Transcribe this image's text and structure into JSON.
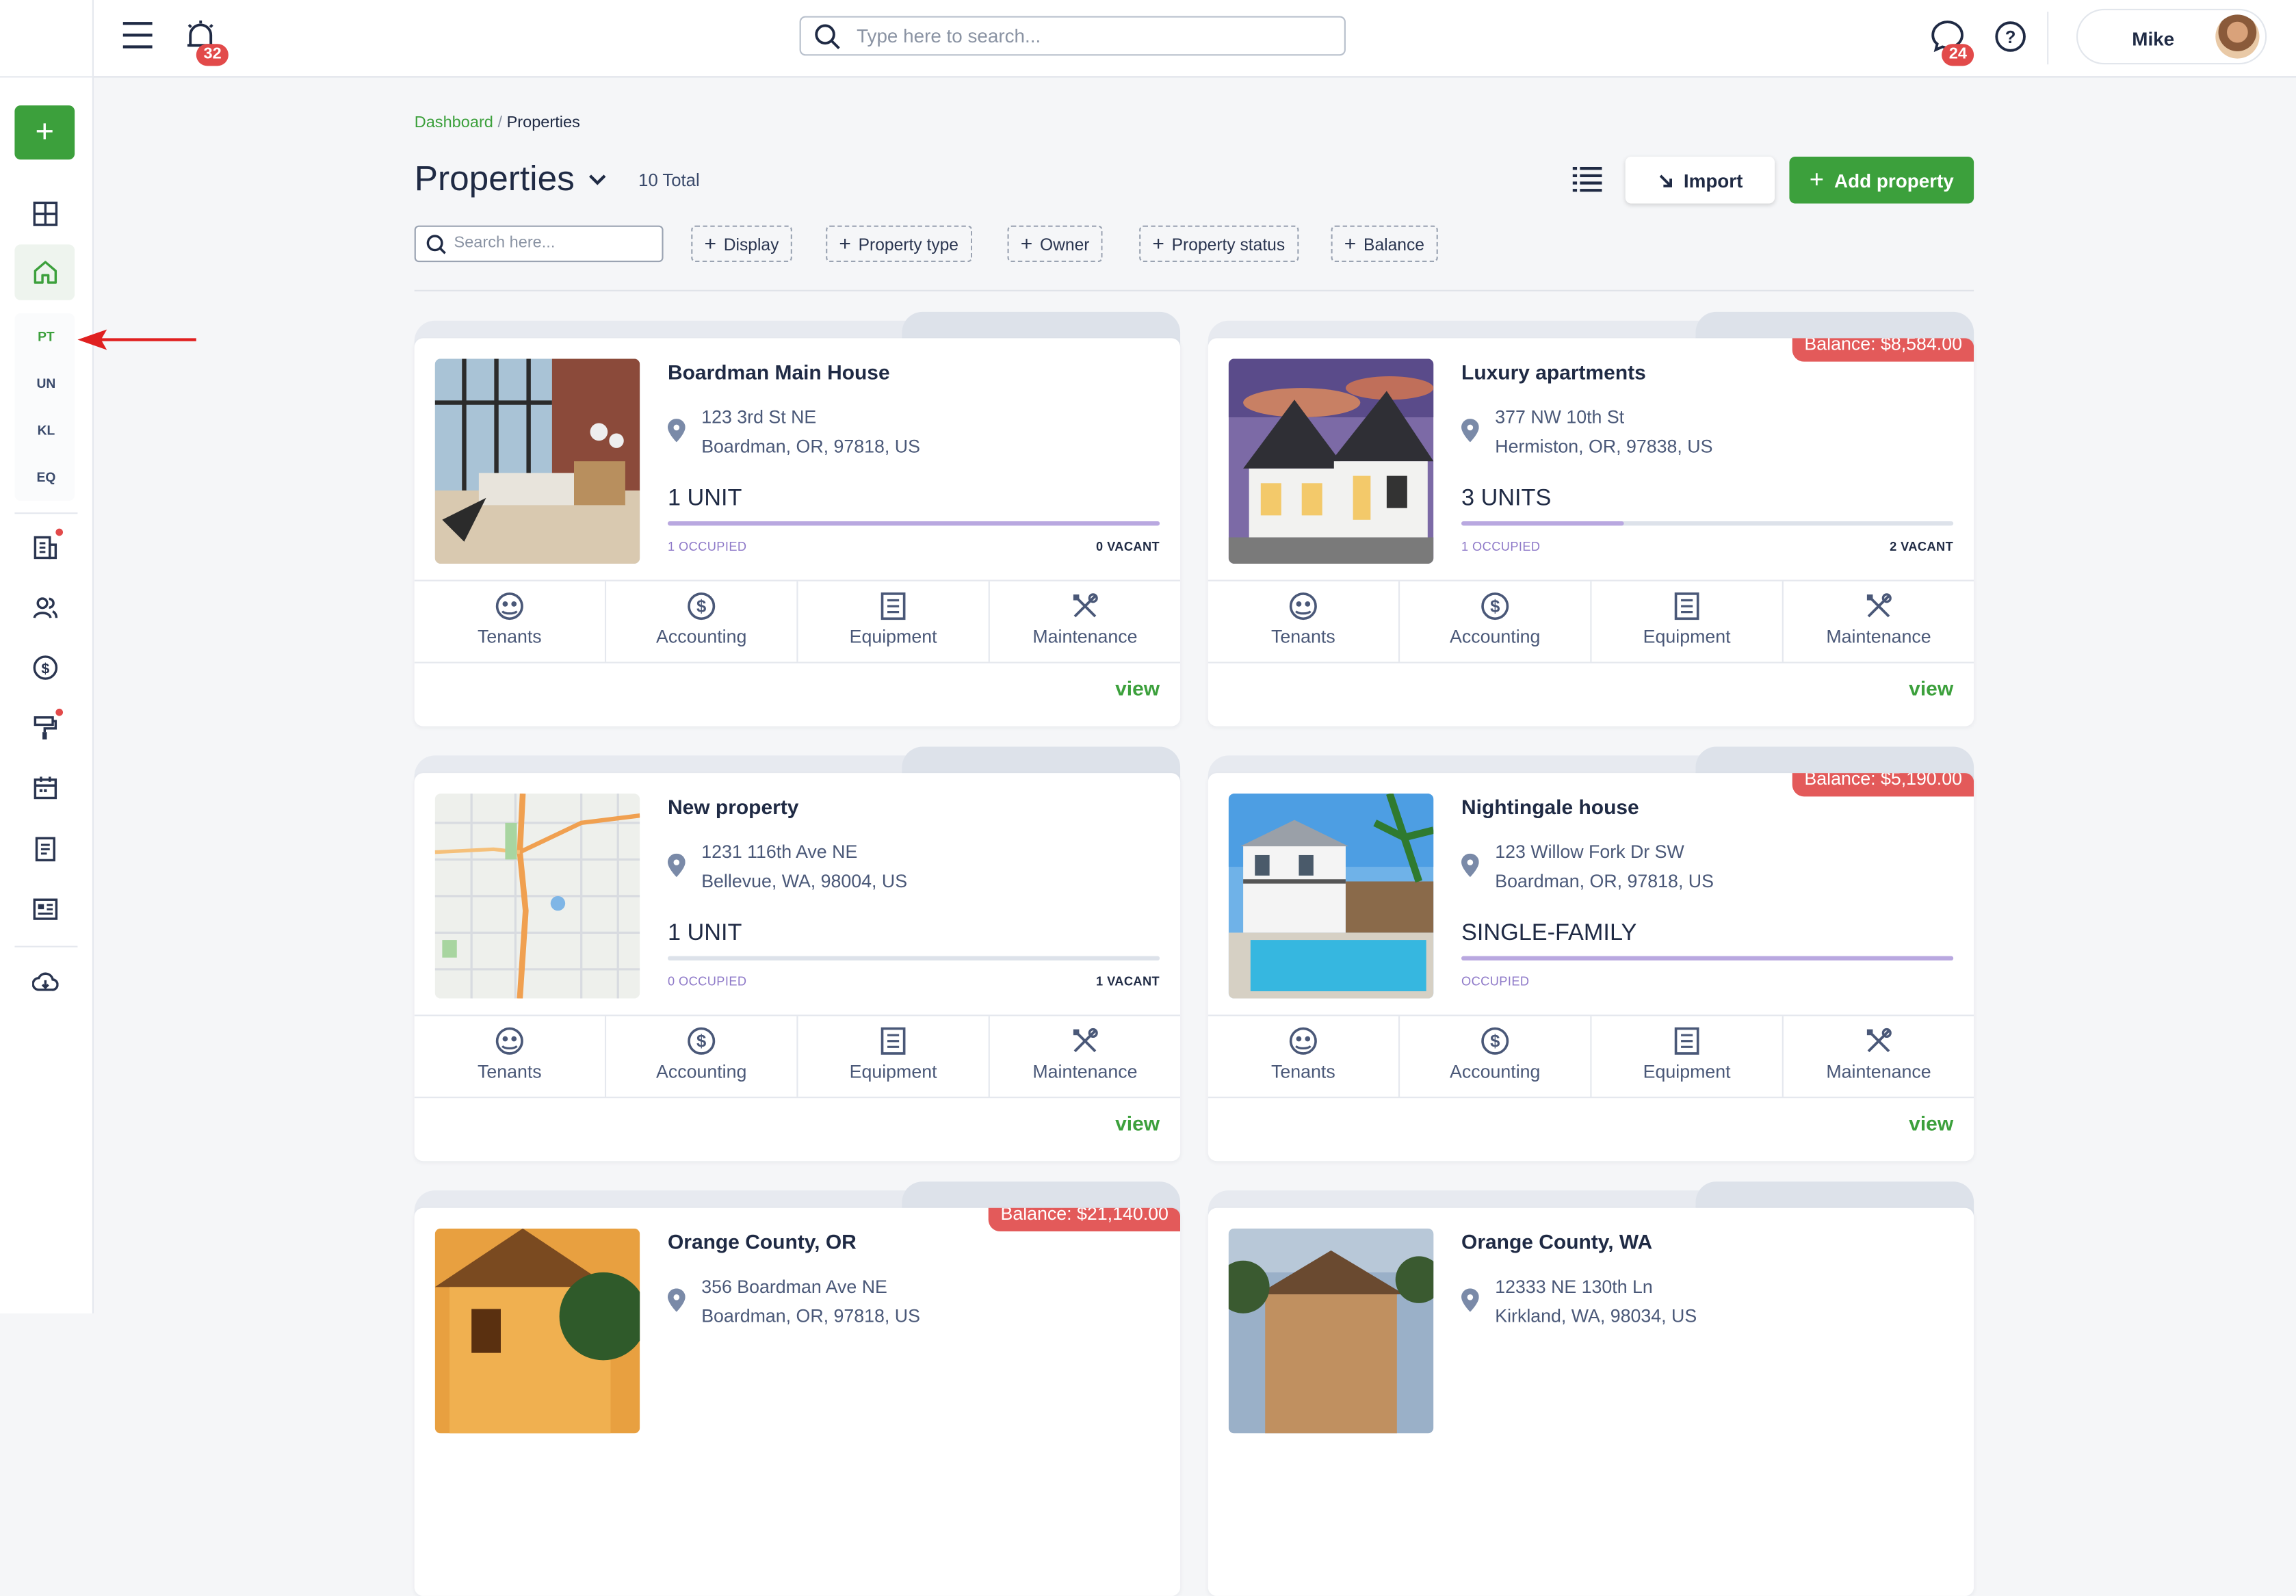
{
  "header": {
    "alarm_count": "32",
    "search_placeholder": "Type here to search...",
    "messages_count": "24",
    "user_name": "Mike"
  },
  "sidebar": {
    "add_label": "+",
    "abbr": [
      "PT",
      "UN",
      "KL",
      "EQ"
    ]
  },
  "breadcrumb": {
    "root": "Dashboard",
    "sep": "/",
    "current": "Properties"
  },
  "page": {
    "title": "Properties",
    "total": "10 Total",
    "import_label": "Import",
    "add_label": "Add property",
    "search_placeholder": "Search here...",
    "filters": [
      "Display",
      "Property type",
      "Owner",
      "Property status",
      "Balance"
    ]
  },
  "card_actions": [
    "Tenants",
    "Accounting",
    "Equipment",
    "Maintenance"
  ],
  "view_label": "view",
  "properties": [
    {
      "name": "Boardman Main House",
      "addr1": "123 3rd St NE",
      "addr2": "Boardman, OR, 97818, US",
      "units": "1 UNIT",
      "occupied": "1 OCCUPIED",
      "vacant": "0 VACANT",
      "occupancy": 1.0,
      "balance": "",
      "image": "interior"
    },
    {
      "name": "Luxury apartments",
      "addr1": "377 NW 10th St",
      "addr2": "Hermiston, OR, 97838, US",
      "units": "3 UNITS",
      "occupied": "1 OCCUPIED",
      "vacant": "2 VACANT",
      "occupancy": 0.33,
      "balance": "Balance: $8,584.00",
      "image": "house-dusk"
    },
    {
      "name": "New property",
      "addr1": "1231 116th Ave NE",
      "addr2": "Bellevue, WA, 98004, US",
      "units": "1 UNIT",
      "occupied": "0 OCCUPIED",
      "vacant": "1 VACANT",
      "occupancy": 0.0,
      "balance": "",
      "image": "map"
    },
    {
      "name": "Nightingale house",
      "addr1": "123 Willow Fork Dr SW",
      "addr2": "Boardman, OR, 97818, US",
      "units": "SINGLE-FAMILY",
      "occupied": "OCCUPIED",
      "vacant": "",
      "occupancy": 1.0,
      "balance": "Balance: $5,190.00",
      "image": "pool-house"
    },
    {
      "name": "Orange County, OR",
      "addr1": "356 Boardman Ave NE",
      "addr2": "Boardman, OR, 97818, US",
      "units": "",
      "occupied": "",
      "vacant": "",
      "occupancy": 0,
      "balance": "Balance: $21,140.00",
      "image": "orange-house"
    },
    {
      "name": "Orange County, WA",
      "addr1": "12333 NE 130th Ln",
      "addr2": "Kirkland, WA, 98034, US",
      "units": "",
      "occupied": "",
      "vacant": "",
      "occupancy": 0,
      "balance": "",
      "image": "cabin"
    }
  ],
  "colors": {
    "accent": "#3ca03c",
    "balance": "#e35a5a",
    "progress": "#b9a8e0"
  }
}
